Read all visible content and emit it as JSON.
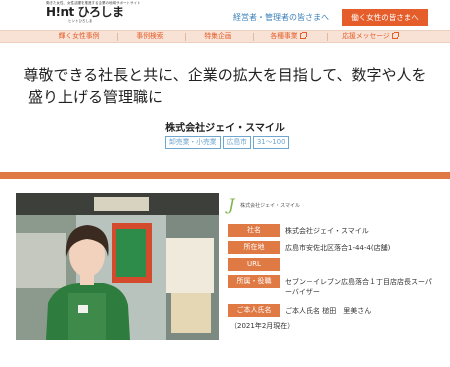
{
  "header": {
    "logo_top": "働きた女性、女性活躍を推進する企業の地域サポートサイト",
    "logo_main": "H!nt ひろしま",
    "logo_sub": "ヒントひろしま",
    "managers_link": "経営者・管理者の皆さまへ",
    "women_button": "働く女性の皆さまへ"
  },
  "nav": {
    "items": [
      {
        "label": "輝く女性事例",
        "external": false
      },
      {
        "label": "事例検索",
        "external": false
      },
      {
        "label": "特集企画",
        "external": false
      },
      {
        "label": "各種事業",
        "external": true
      },
      {
        "label": "応援メッセージ",
        "external": true
      }
    ]
  },
  "article": {
    "headline_line1": "尊敬できる社長と共に、企業の拡大を目指して、数字や人を",
    "headline_line2": "盛り上げる管理職に",
    "company": "株式会社ジェイ・スマイル",
    "tags": [
      "卸売業・小売業",
      "広島市",
      "31～100"
    ]
  },
  "profile": {
    "corp_logo_text": "株式会社ジェイ・スマイル",
    "rows": [
      {
        "label": "社名",
        "value": "株式会社ジェイ・スマイル"
      },
      {
        "label": "所在地",
        "value": "広島市安佐北区落合1-44-4(店舗)"
      },
      {
        "label": "URL",
        "value": ""
      },
      {
        "label": "所属・役職",
        "value": "セブン－イレブン広島落合１丁目店店長スーパーバイザー"
      },
      {
        "label": "ご本人氏名",
        "value": "ご本人氏名 槌田　里美さん"
      }
    ],
    "note": "（2021年2月現在）"
  },
  "colors": {
    "accent": "#e45d2a",
    "label_bg": "#e07a45",
    "nav_bg": "#f7e2d5",
    "link": "#3a7fb8",
    "tag": "#6fa6d0"
  }
}
